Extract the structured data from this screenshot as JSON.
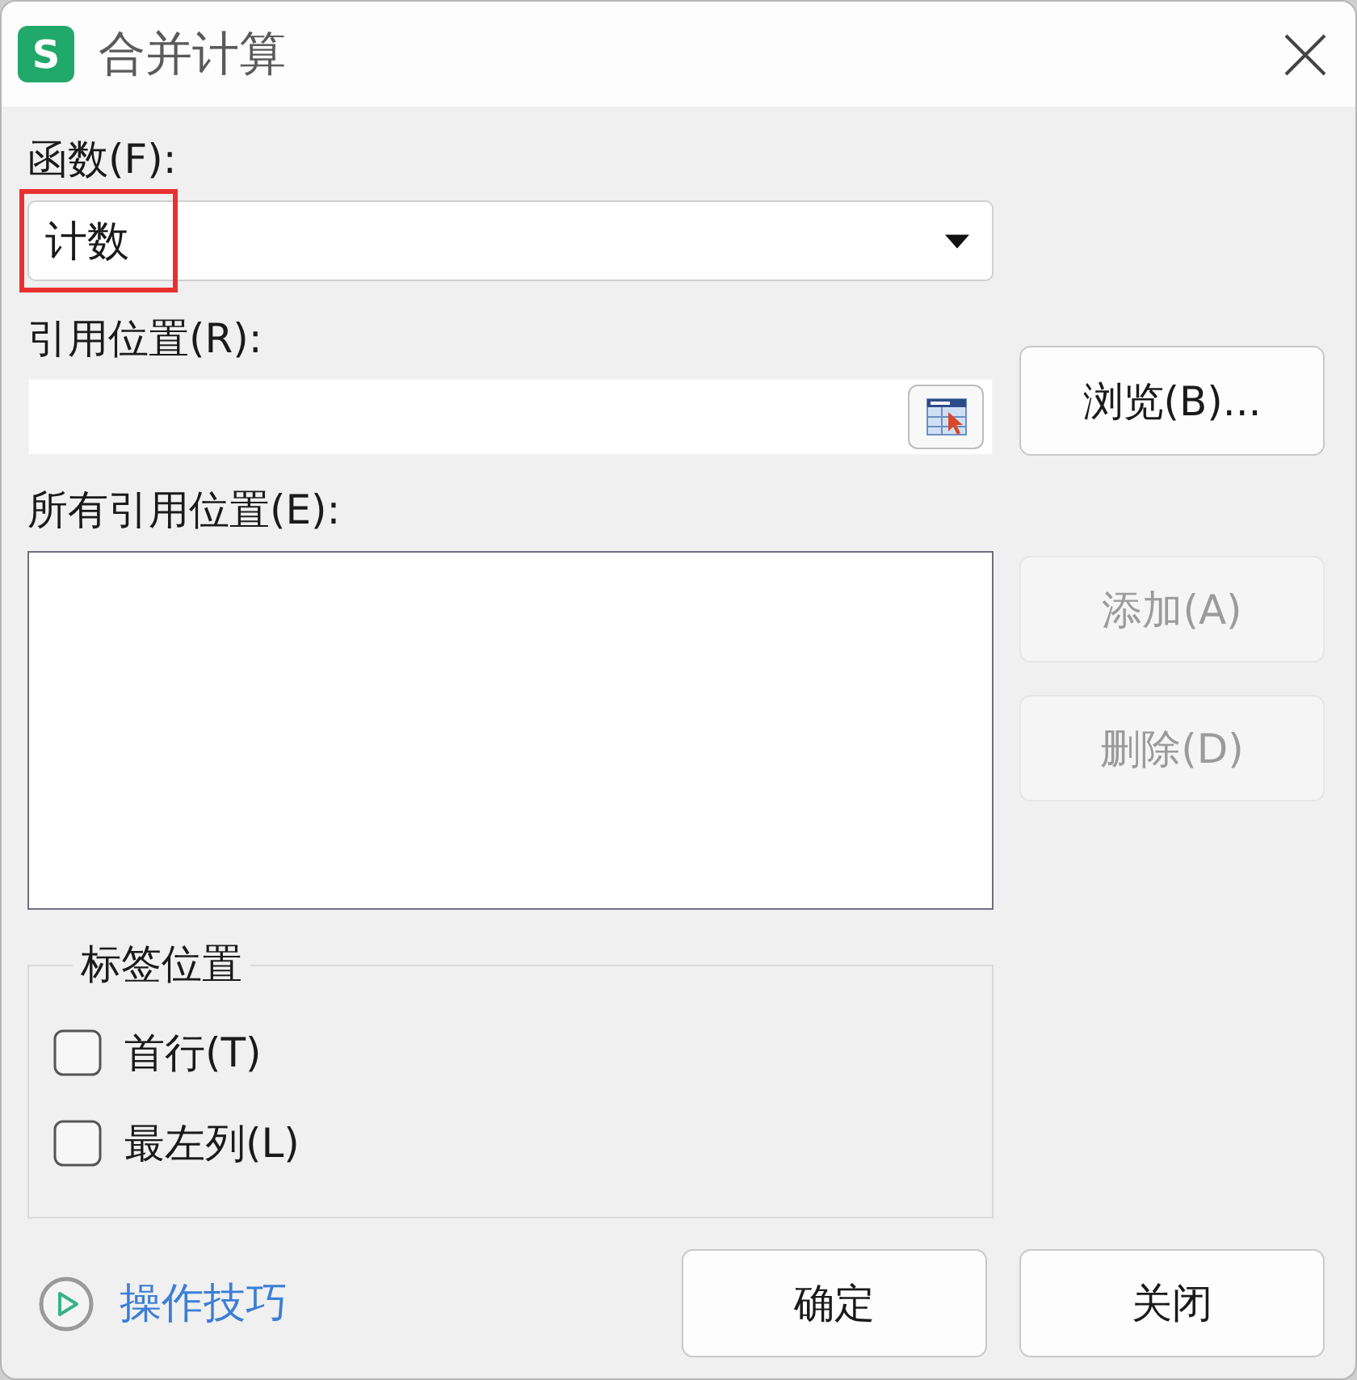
{
  "window": {
    "title": "合并计算",
    "logo_letter": "S"
  },
  "function": {
    "label": "函数(F):",
    "value": "计数",
    "highlighted": true
  },
  "reference": {
    "label": "引用位置(R):"
  },
  "browse_button": {
    "label": "浏览(B)...",
    "disabled": false
  },
  "all_references": {
    "label": "所有引用位置(E):"
  },
  "side_buttons": [
    {
      "label": "添加(A)",
      "disabled": true
    },
    {
      "label": "删除(D)",
      "disabled": true
    }
  ],
  "label_position": {
    "title": "标签位置",
    "options": [
      {
        "label": "首行(T)",
        "checked": false
      },
      {
        "label": "最左列(L)",
        "checked": false
      }
    ]
  },
  "tips_link": "操作技巧",
  "footer_buttons": [
    {
      "label": "确定",
      "disabled": false
    },
    {
      "label": "关闭",
      "disabled": false
    }
  ]
}
